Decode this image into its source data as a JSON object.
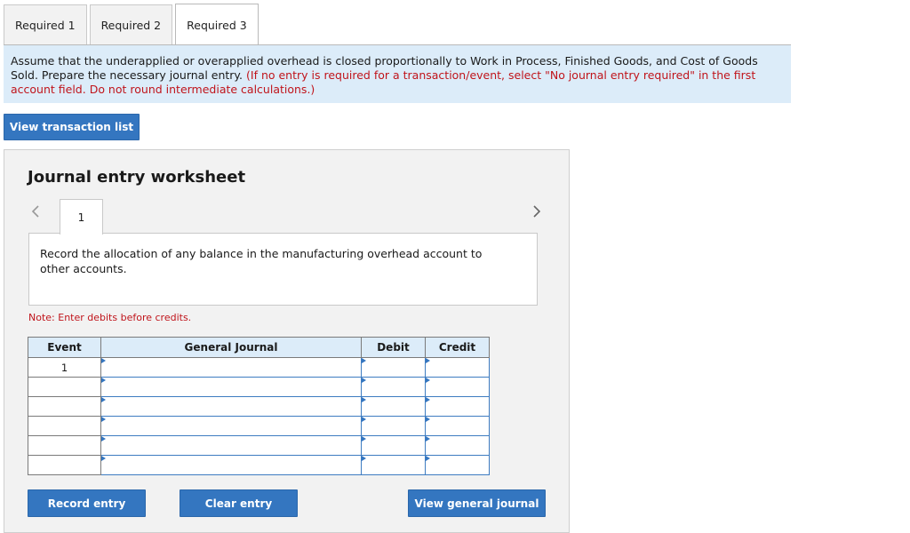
{
  "tabs": [
    {
      "label": "Required 1",
      "active": false
    },
    {
      "label": "Required 2",
      "active": false
    },
    {
      "label": "Required 3",
      "active": true
    }
  ],
  "instructions": {
    "text": "Assume that the underapplied or overapplied overhead is closed proportionally to Work in Process, Finished Goods, and Cost of Goods Sold. Prepare the necessary journal entry.",
    "note": "(If no entry is required for a transaction/event, select \"No journal entry required\" in the first account field. Do not round intermediate calculations.)"
  },
  "view_transaction_list_label": "View transaction list",
  "worksheet": {
    "title": "Journal entry worksheet",
    "current_page": "1",
    "description": "Record the allocation of any balance in the manufacturing overhead account to other accounts.",
    "note": "Note: Enter debits before credits.",
    "table": {
      "headers": {
        "event": "Event",
        "general_journal": "General Journal",
        "debit": "Debit",
        "credit": "Credit"
      },
      "rows": [
        {
          "event": "1",
          "account": "",
          "debit": "",
          "credit": ""
        },
        {
          "event": "",
          "account": "",
          "debit": "",
          "credit": ""
        },
        {
          "event": "",
          "account": "",
          "debit": "",
          "credit": ""
        },
        {
          "event": "",
          "account": "",
          "debit": "",
          "credit": ""
        },
        {
          "event": "",
          "account": "",
          "debit": "",
          "credit": ""
        },
        {
          "event": "",
          "account": "",
          "debit": "",
          "credit": ""
        }
      ]
    },
    "buttons": {
      "record": "Record entry",
      "clear": "Clear entry",
      "view_journal": "View general journal"
    }
  },
  "colors": {
    "accent": "#3476c0",
    "instruction_bg": "#dcecf9",
    "note_red": "#c0141b",
    "panel_bg": "#f2f2f2"
  },
  "icons": {
    "prev": "chevron-left-icon",
    "next": "chevron-right-icon",
    "cell_marker": "triangle-marker-icon"
  }
}
